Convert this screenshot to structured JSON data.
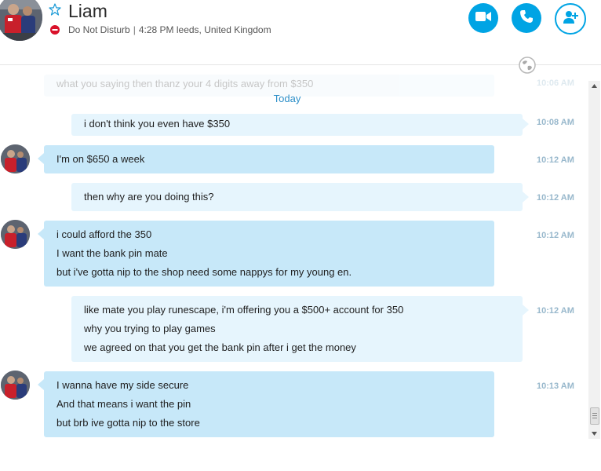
{
  "contact": {
    "name": "Liam",
    "presence": "Do Not Disturb",
    "separator": "|",
    "local_time": "4:28 PM leeds, United Kingdom"
  },
  "header_actions": [
    {
      "label": "video-call",
      "icon": "video-camera-icon"
    },
    {
      "label": "audio-call",
      "icon": "phone-icon"
    },
    {
      "label": "add-people",
      "icon": "add-person-icon"
    }
  ],
  "colors": {
    "accent": "#00a4e4",
    "incoming_bubble": "#c7e8f9",
    "outgoing_bubble": "#e6f5fd",
    "timestamp": "#98b8cc",
    "day_divider": "#2b8ec8",
    "dnd": "#d9112a"
  },
  "chat": {
    "faded_message": "what you saying then thanz your 4 digits away from $350",
    "faded_time": "10:06 AM",
    "day_divider": "Today",
    "messages": [
      {
        "direction": "outgoing",
        "time": "10:08 AM",
        "lines": [
          "i don't think you even have $350"
        ]
      },
      {
        "direction": "incoming",
        "time": "10:12 AM",
        "lines": [
          "I'm on $650 a week"
        ]
      },
      {
        "direction": "outgoing",
        "time": "10:12 AM",
        "lines": [
          "then why are you doing this?"
        ]
      },
      {
        "direction": "incoming",
        "time": "10:12 AM",
        "lines": [
          "i could afford the 350",
          "I want the bank pin mate",
          "but i've gotta nip to the shop need some nappys for my young en."
        ]
      },
      {
        "direction": "outgoing",
        "time": "10:12 AM",
        "lines": [
          "like mate you play runescape, i'm offering you a $500+ account for 350",
          "why you trying to play games",
          "we agreed on that you get the bank pin after i get the money"
        ]
      },
      {
        "direction": "incoming",
        "time": "10:13 AM",
        "lines": [
          "I wanna have my side secure",
          "And that means i want the pin",
          "but brb ive gotta nip to the store"
        ]
      }
    ]
  }
}
